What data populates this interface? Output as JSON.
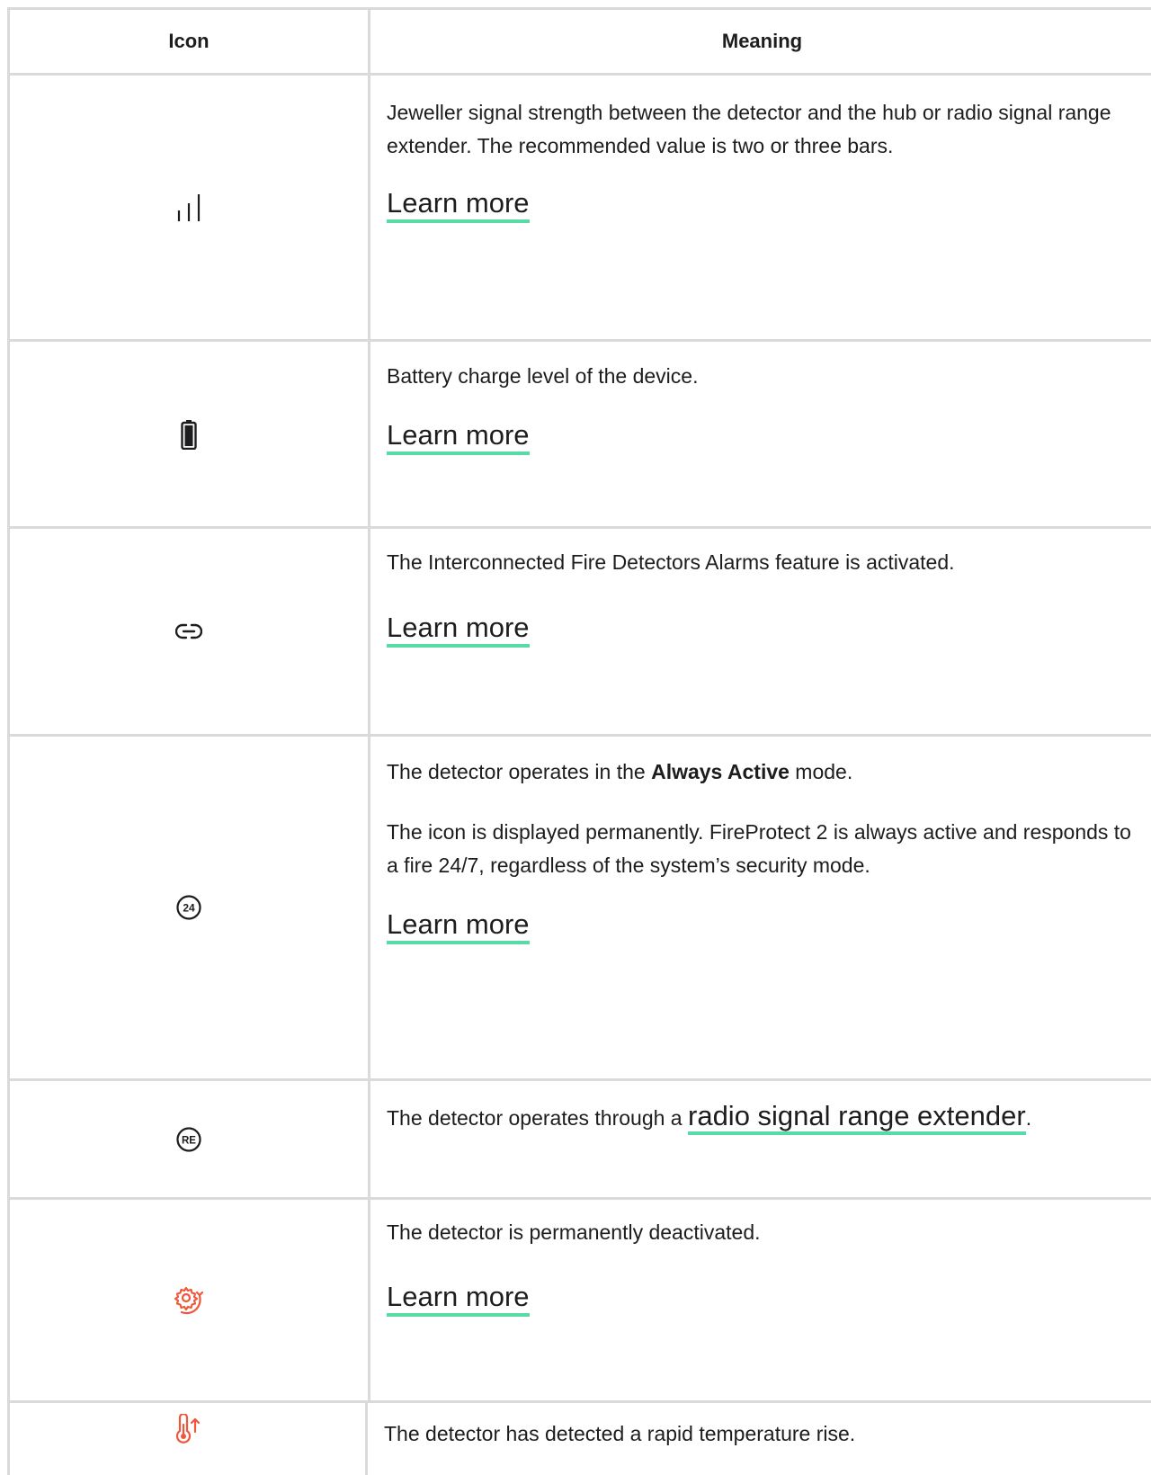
{
  "table": {
    "header": {
      "icon": "Icon",
      "meaning": "Meaning"
    },
    "rows": [
      {
        "icon_name": "signal-strength-icon",
        "text": "Jeweller signal strength between the detector and the hub or radio signal range extender. The recommended value is two or three bars.",
        "link": "Learn more"
      },
      {
        "icon_name": "battery-icon",
        "text": "Battery charge level of the device.",
        "link": "Learn more"
      },
      {
        "icon_name": "link-icon",
        "text": "The Interconnected Fire Detectors Alarms feature is activated.",
        "link": "Learn more"
      },
      {
        "icon_name": "always-active-24-icon",
        "icon_label": "24",
        "text_before": "The detector operates in the ",
        "text_bold": "Always Active",
        "text_after": " mode.",
        "text2": "The icon is displayed permanently. FireProtect 2 is always active and responds to a fire 24/7, regardless of the system’s security mode.",
        "link": "Learn more"
      },
      {
        "icon_name": "range-extender-re-icon",
        "icon_label": "RE",
        "text_before": "The detector operates through a ",
        "link": "radio signal range extender",
        "text_after": "."
      },
      {
        "icon_name": "deactivated-gear-icon",
        "icon_color": "#f0573a",
        "text": "The detector is permanently deactivated.",
        "link": "Learn more"
      },
      {
        "icon_name": "temperature-rise-icon",
        "icon_color": "#f0573a",
        "text": "The detector has detected a rapid temperature rise."
      }
    ]
  },
  "colors": {
    "border": "#dadada",
    "link_underline": "#58dca5",
    "alert_icon": "#f0573a",
    "text": "#1d1d1f"
  }
}
